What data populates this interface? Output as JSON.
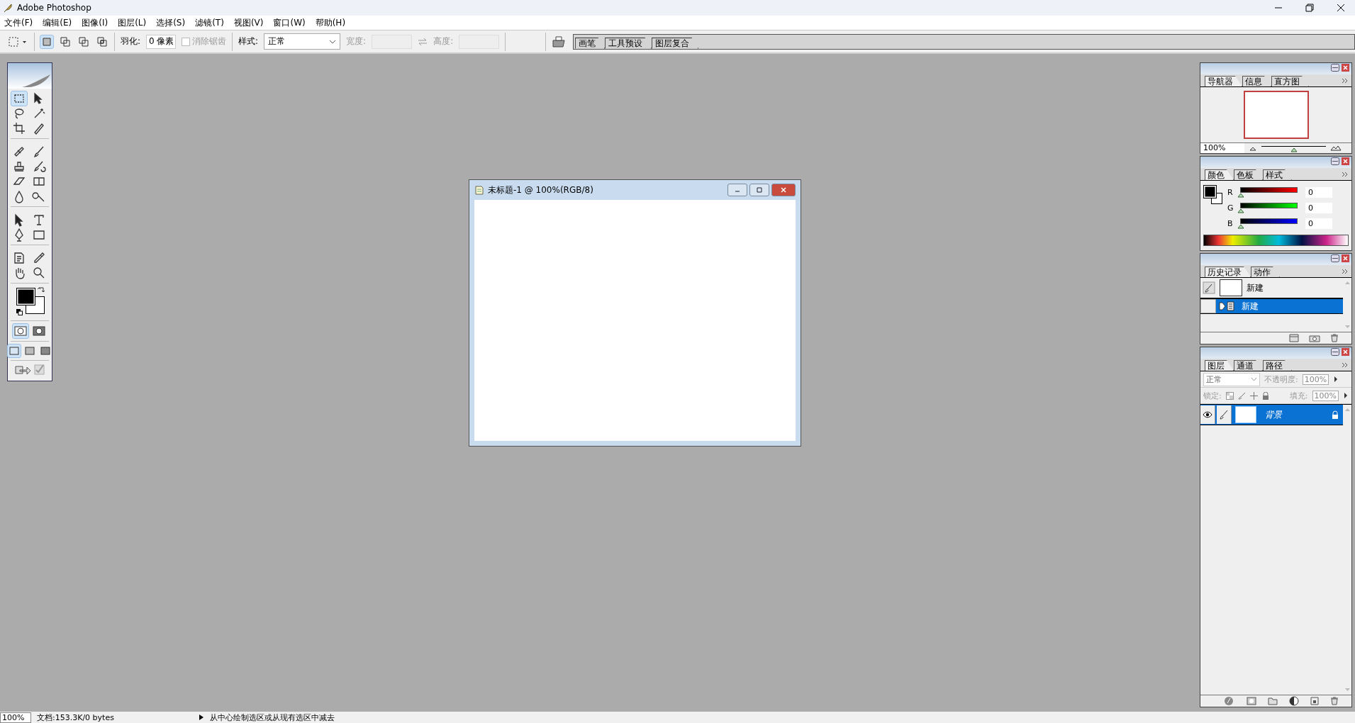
{
  "window": {
    "title": "Adobe Photoshop"
  },
  "menu": [
    "文件(F)",
    "编辑(E)",
    "图像(I)",
    "图层(L)",
    "选择(S)",
    "滤镜(T)",
    "视图(V)",
    "窗口(W)",
    "帮助(H)"
  ],
  "options_bar": {
    "selection_modes": [
      {
        "kind": "new",
        "selected": true
      },
      {
        "kind": "add",
        "selected": false
      },
      {
        "kind": "subtract",
        "selected": false
      },
      {
        "kind": "intersect",
        "selected": false
      }
    ],
    "feather_label": "羽化:",
    "feather_value": "0 像素",
    "antialias": {
      "label": "消除锯齿",
      "checked": false,
      "disabled": true
    },
    "style_label": "样式:",
    "style_value": "正常",
    "width_label": "宽度:",
    "height_label": "高度:",
    "well_tabs": [
      "画笔",
      "工具预设",
      "图层复合"
    ]
  },
  "toolbox": {
    "groups": [
      [
        {
          "kind": "marquee",
          "selected": true
        },
        {
          "kind": "move",
          "selected": false
        },
        {
          "kind": "lasso",
          "selected": false
        },
        {
          "kind": "magic-wand",
          "selected": false
        },
        {
          "kind": "crop",
          "selected": false
        },
        {
          "kind": "slice",
          "selected": false
        }
      ],
      [
        {
          "kind": "healing",
          "selected": false
        },
        {
          "kind": "brush",
          "selected": false
        },
        {
          "kind": "stamp",
          "selected": false
        },
        {
          "kind": "history-brush",
          "selected": false
        },
        {
          "kind": "eraser",
          "selected": false
        },
        {
          "kind": "gradient",
          "selected": false
        },
        {
          "kind": "blur",
          "selected": false
        },
        {
          "kind": "dodge",
          "selected": false
        }
      ],
      [
        {
          "kind": "path-select",
          "selected": false
        },
        {
          "kind": "type",
          "selected": false
        },
        {
          "kind": "pen",
          "selected": false
        },
        {
          "kind": "shape",
          "selected": false
        }
      ],
      [
        {
          "kind": "notes",
          "selected": false
        },
        {
          "kind": "eyedropper",
          "selected": false
        },
        {
          "kind": "hand",
          "selected": false
        },
        {
          "kind": "zoom",
          "selected": false
        }
      ]
    ],
    "modes": [
      {
        "kind": "standard",
        "selected": true
      },
      {
        "kind": "quick-mask",
        "selected": false
      }
    ],
    "screens": [
      {
        "kind": "standard",
        "selected": true
      },
      {
        "kind": "full-menu",
        "selected": false
      },
      {
        "kind": "full",
        "selected": false
      }
    ]
  },
  "document": {
    "title": "未标题-1 @ 100%(RGB/8)"
  },
  "navigator": {
    "tabs": [
      {
        "label": "导航器",
        "selected": true
      },
      {
        "label": "信息",
        "selected": false
      },
      {
        "label": "直方图",
        "selected": false
      }
    ],
    "zoom": "100%",
    "level": 0.5
  },
  "color": {
    "tabs": [
      {
        "label": "颜色",
        "selected": true
      },
      {
        "label": "色板",
        "selected": false
      },
      {
        "label": "样式",
        "selected": false
      }
    ],
    "channels": [
      {
        "label": "R",
        "value": "0",
        "level": 0,
        "kind": "red"
      },
      {
        "label": "G",
        "value": "0",
        "level": 0,
        "kind": "green"
      },
      {
        "label": "B",
        "value": "0",
        "level": 0,
        "kind": "blue"
      }
    ]
  },
  "history": {
    "tabs": [
      {
        "label": "历史记录",
        "selected": true
      },
      {
        "label": "动作",
        "selected": false
      }
    ],
    "snapshot": "新建",
    "items": [
      {
        "label": "新建",
        "selected": true
      }
    ]
  },
  "layers": {
    "tabs": [
      {
        "label": "图层",
        "selected": true
      },
      {
        "label": "通道",
        "selected": false
      },
      {
        "label": "路径",
        "selected": false
      }
    ],
    "blend_mode": "正常",
    "opacity_label": "不透明度:",
    "opacity": "100%",
    "lock_label": "锁定:",
    "fill_label": "填充:",
    "fill": "100%",
    "items": [
      {
        "name": "背景",
        "selected": true,
        "visible": true,
        "locked": true
      }
    ]
  },
  "status_bar": {
    "zoom": "100%",
    "document": "文档:153.3K/0 bytes",
    "hint": "从中心绘制选区或从现有选区中减去"
  }
}
